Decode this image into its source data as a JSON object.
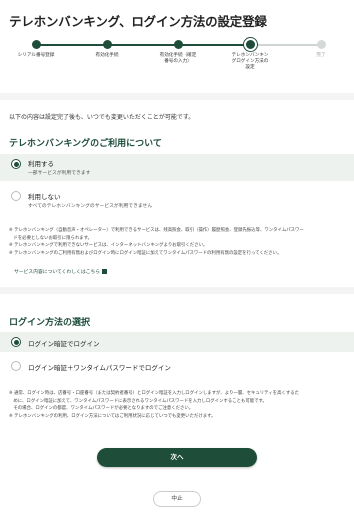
{
  "page": {
    "title": "テレホンバンキング、ログイン方法の設定登録"
  },
  "stepper": {
    "steps": [
      {
        "label": "シリアル番号登録",
        "state": "done"
      },
      {
        "label": "有効化手続",
        "state": "done"
      },
      {
        "label": "有効化手続（確定\n番号の入力）",
        "state": "done"
      },
      {
        "label": "テレホンバンキン\nグログイン方法の\n設定",
        "state": "current"
      },
      {
        "label": "完了",
        "state": "todo"
      }
    ]
  },
  "intro": "以下の内容は設定完了後も、いつでも変更いただくことが可能です。",
  "telebank": {
    "title": "テレホンバンキングのご利用について",
    "options": [
      {
        "label": "利用する",
        "sub": "一部サービスが利用できます",
        "selected": true
      },
      {
        "label": "利用しない",
        "sub": "すべてのテレホンバンキングのサービスが利用できません",
        "selected": false
      }
    ],
    "notes": [
      "※ テレホンバンキング（自動音声・オペレーター）で利用できるサービスは、残高照会、取引（操作）履歴照会、登録先振込等、ワンタイムパスワー",
      "　ドを必要としないお取引に限られます。",
      "※ テレホンバンキングで利用できないサービスは、インターネットバンキングよりお取引ください。",
      "※ テレホンバンキングのご利用有無およびログイン時にログイン暗証に加えてワンタイムパスワードの利用有無の設定を行ってください。"
    ],
    "link": "サービス内容についてくわしくはこちら"
  },
  "login": {
    "title": "ログイン方法の選択",
    "options": [
      {
        "label": "ログイン暗証でログイン",
        "selected": true
      },
      {
        "label": "ログイン暗証＋ワンタイムパスワードでログイン",
        "selected": false
      }
    ],
    "notes": [
      "※ 通常、ログイン時は、店番号・口座番号（または契約者番号）とログイン暗証を入力しログインしますが、より一層、セキュリティを高くするた",
      "　めに、ログイン暗証に加えて、ワンタイムパスワードに表示されるワンタイムパスワードを入力しログインすることも可能です。",
      "　その場合、ログインの都度、ワンタイムパスワードが必要となりますのでご注意ください。",
      "※ テレホンバンキングの利用、ログイン方法についてはご利用状況に応じていつでも変更いただけます。"
    ]
  },
  "buttons": {
    "next": "次へ",
    "cancel": "中止"
  }
}
